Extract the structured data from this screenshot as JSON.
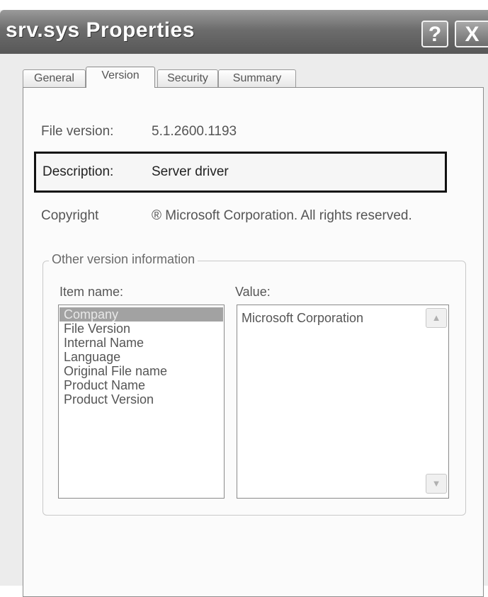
{
  "window": {
    "title": "srv.sys Properties",
    "help_label": "?",
    "close_label": "X"
  },
  "tabs": [
    {
      "label": "General",
      "active": false
    },
    {
      "label": "Version",
      "active": true
    },
    {
      "label": "Security",
      "active": false
    },
    {
      "label": "Summary",
      "active": false
    }
  ],
  "version": {
    "file_version_label": "File version:",
    "file_version_value": "5.1.2600.1193",
    "description_label": "Description:",
    "description_value": "Server driver",
    "copyright_label": "Copyright",
    "copyright_value": "® Microsoft Corporation. All rights reserved."
  },
  "other": {
    "legend": "Other version information",
    "item_header": "Item name:",
    "value_header": "Value:",
    "items": [
      "Company",
      "File Version",
      "Internal Name",
      "Language",
      "Original File name",
      "Product Name",
      "Product Version"
    ],
    "selected_index": 0,
    "selected_value": "Microsoft Corporation"
  },
  "icons": {
    "scroll_up": "chevron-up-icon",
    "scroll_down": "chevron-down-icon"
  }
}
